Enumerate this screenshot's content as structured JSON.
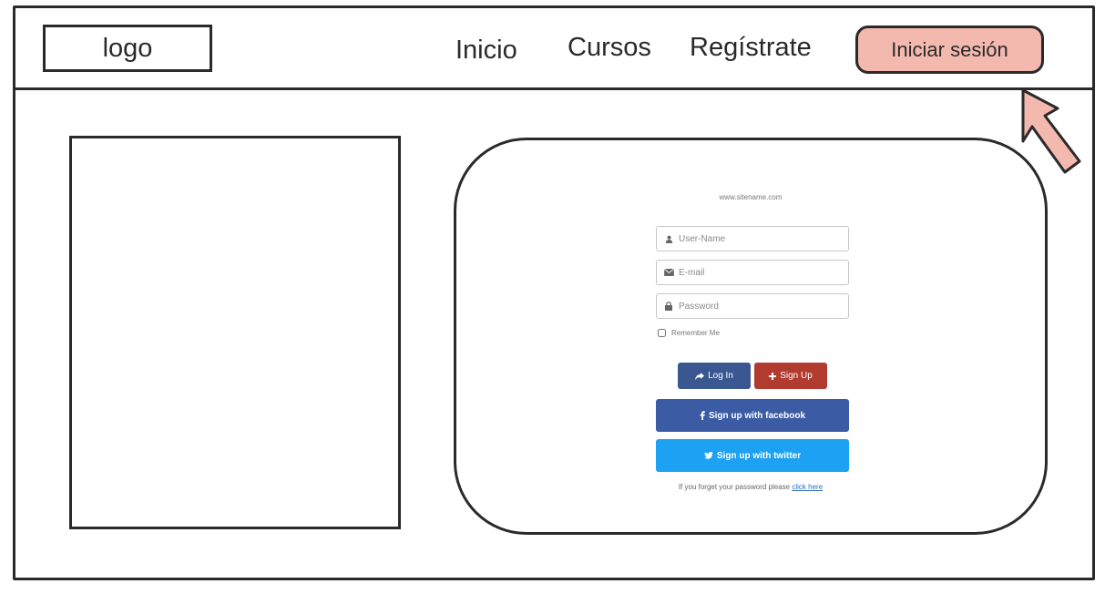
{
  "header": {
    "logo_text": "logo",
    "nav": {
      "inicio": "Inicio",
      "cursos": "Cursos",
      "registrate": "Regístrate"
    },
    "login_button": "Iniciar sesión"
  },
  "form": {
    "site_url": "www.sitename.com",
    "username_placeholder": "User-Name",
    "email_placeholder": "E-mail",
    "password_placeholder": "Password",
    "remember_label": "Remember Me",
    "login_label": "Log In",
    "signup_label": "Sign Up",
    "facebook_label": "Sign up with facebook",
    "twitter_label": "Sign up with twitter",
    "forgot_text": "If you forget your password please",
    "forgot_link": "click here"
  },
  "icons": {
    "user": "user-icon",
    "email": "envelope-icon",
    "password": "lock-icon",
    "login": "share-arrow-icon",
    "signup": "plus-icon",
    "facebook": "facebook-icon",
    "twitter": "twitter-icon"
  },
  "colors": {
    "login_button_bg": "#f4b9ae",
    "btn_login": "#3a5791",
    "btn_signup": "#b13b2e",
    "facebook": "#3b5ba4",
    "twitter": "#1da1f2",
    "arrow_fill": "#f4b9ae"
  }
}
